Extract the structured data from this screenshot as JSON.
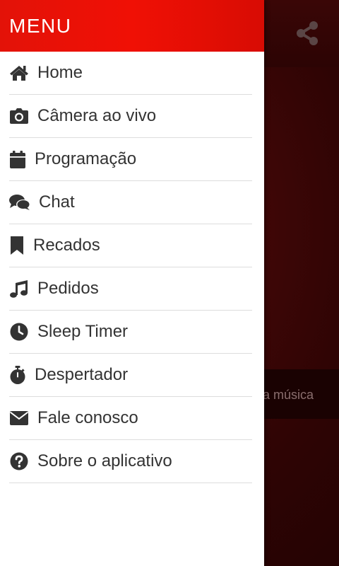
{
  "drawer": {
    "title": "MENU",
    "items": [
      {
        "label": "Home",
        "icon": "home-icon"
      },
      {
        "label": "Câmera ao vivo",
        "icon": "camera-icon"
      },
      {
        "label": "Programação",
        "icon": "calendar-icon"
      },
      {
        "label": "Chat",
        "icon": "chat-icon"
      },
      {
        "label": "Recados",
        "icon": "bookmark-icon"
      },
      {
        "label": "Pedidos",
        "icon": "music-icon"
      },
      {
        "label": "Sleep Timer",
        "icon": "clock-icon"
      },
      {
        "label": "Despertador",
        "icon": "stopwatch-icon"
      },
      {
        "label": "Fale conosco",
        "icon": "envelope-icon"
      },
      {
        "label": "Sobre o aplicativo",
        "icon": "question-icon"
      }
    ]
  },
  "background": {
    "share_icon": "share-icon",
    "now_playing_partial": "a música"
  },
  "colors": {
    "header_red": "#e31208",
    "icon_dark": "#333333",
    "background_dark_red": "#2e0404"
  }
}
